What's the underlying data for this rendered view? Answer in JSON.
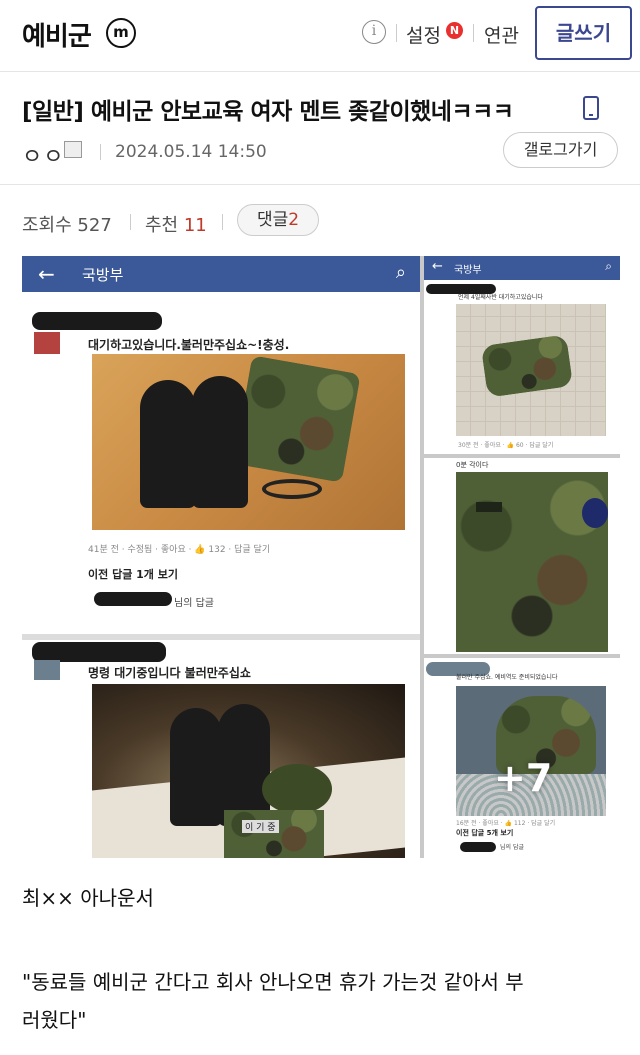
{
  "header": {
    "site_title": "예비군",
    "m_badge": "m",
    "info_icon": "i",
    "settings_label": "설정",
    "new_badge": "N",
    "related_label": "연관",
    "write_button": "글쓰기"
  },
  "post": {
    "title": "[일반] 예비군 안보교육 여자 멘트 좆같이했네ㅋㅋㅋ",
    "author": "ㅇㅇ",
    "date": "2024.05.14 14:50",
    "gallery_button": "갤로그가기",
    "views_label": "조회수",
    "views": "527",
    "recommend_label": "추천",
    "recommend": "11",
    "comments_label": "댓글",
    "comments": "2"
  },
  "embedded": {
    "left_page_name": "국방부",
    "right_page_name": "국방부",
    "post1_text": "대기하고있습니다.불러만주십쇼~!충성.",
    "post1_meta": "41분 전 · 수정됨 · 좋아요 · 👍 132 · 답글 달기",
    "post1_prev": "이전 답글 1개 보기",
    "post1_reply": "님의 답글",
    "post2_text": "명령 대기중입니다 불러만주십쇼",
    "right1_text": "언제 4일째사반 대기하고있습니다",
    "right1_meta": "30분 전 · 좋아요 · 👍 60 · 답글 달기",
    "right2_text": "0분 각이다",
    "right3_text": "불러만 주십쇼. 예비역도 준비되었습니다",
    "right3_meta": "16분 전 · 좋아요 · 👍 112 · 답글 달기",
    "right3_prev": "이전 답글 5개 보기",
    "right3_reply": "님의 답글",
    "more_count": "+7",
    "name_tag": "이 기 중"
  },
  "caption": {
    "speaker": "최×× 아나운서",
    "quote_line1": "\"동료들 예비군 간다고 회사 안나오면 휴가 가는것 같아서 부",
    "quote_line2": "러웠다\""
  },
  "colors": {
    "accent": "#3b4890",
    "badge_red": "#e8312f",
    "count_red": "#c0392b",
    "facebook_blue": "#3b5998"
  },
  "icons": [
    "m-badge-icon",
    "info-icon",
    "new-badge-icon",
    "mobile-icon",
    "member-icon",
    "back-arrow-icon",
    "search-icon",
    "thumbs-up-icon"
  ]
}
